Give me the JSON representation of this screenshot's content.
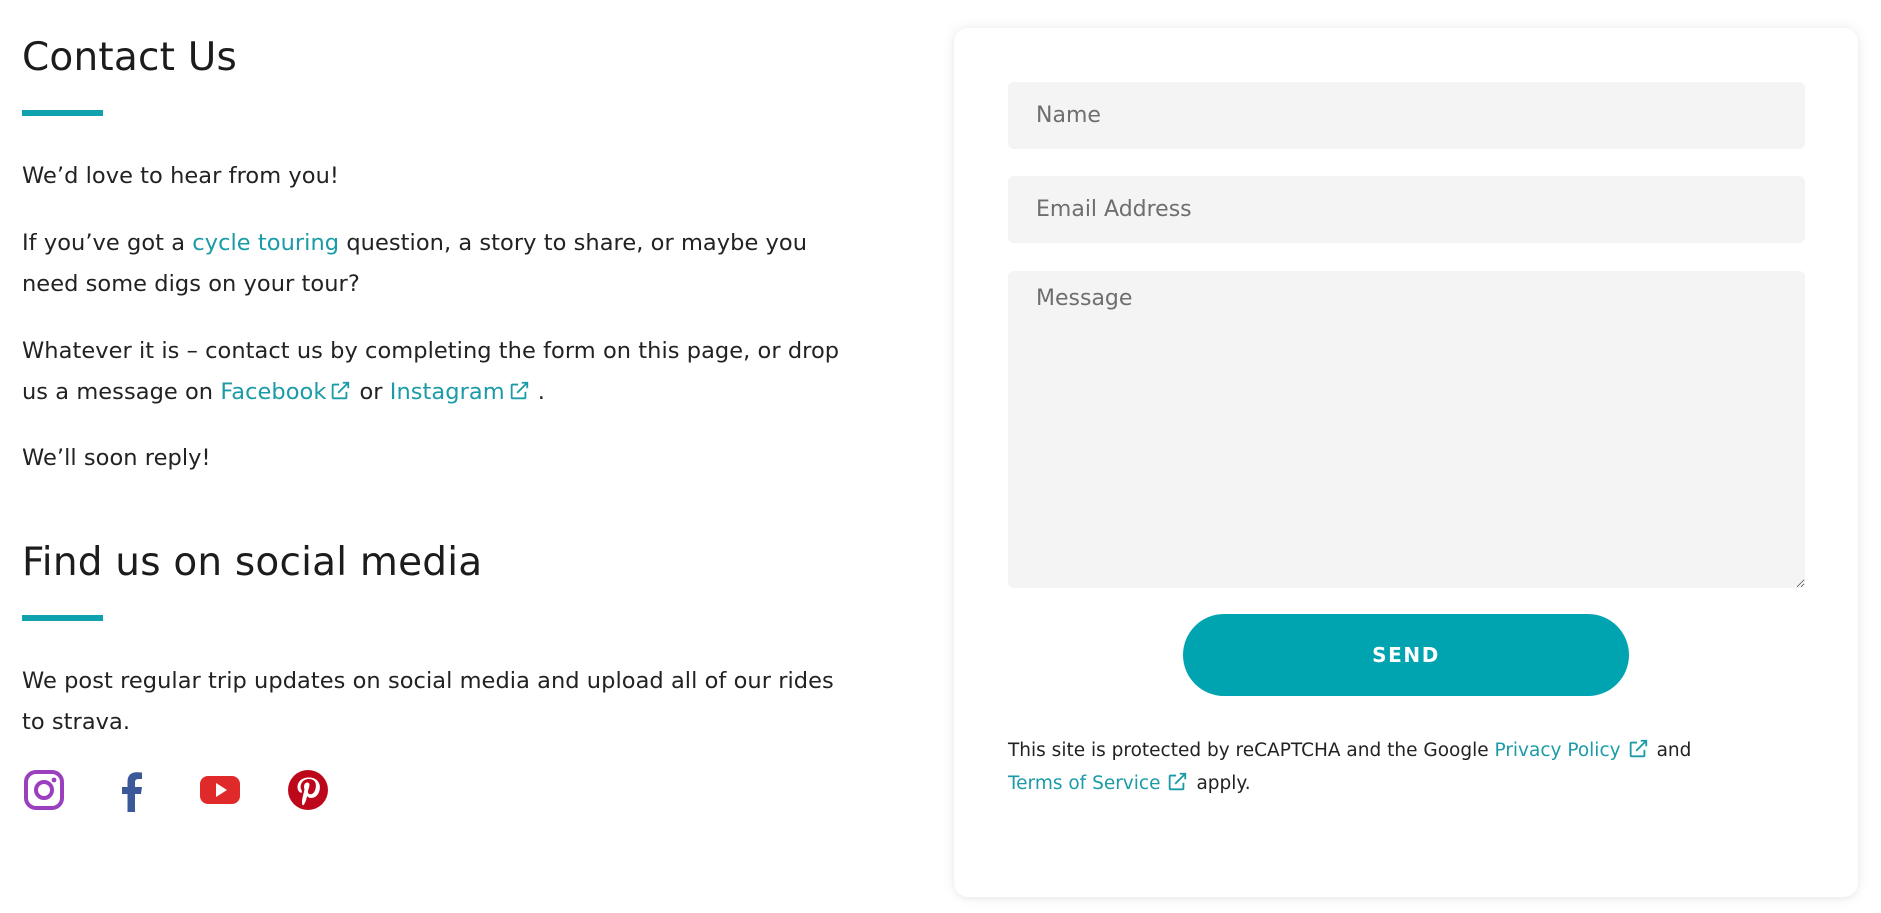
{
  "colors": {
    "accent": "#00a3b0",
    "link": "#1a9ba7",
    "field_bg": "#f4f4f4",
    "instagram": "#9b3fbf",
    "facebook": "#3b5998",
    "youtube": "#e02a2a",
    "pinterest": "#bd081c"
  },
  "contact": {
    "title": "Contact Us",
    "intro": "We’d love to hear from you!",
    "para2": {
      "before": "If you’ve got a ",
      "link": "cycle touring",
      "after": " question, a story to share, or maybe you need some digs on your tour?"
    },
    "para3": {
      "before": "Whatever it is – contact us by completing the form on this page, or drop us a message on ",
      "facebook_link": "Facebook",
      "middle": "or ",
      "instagram_link": "Instagram",
      "after": "."
    },
    "closing": "We’ll soon reply!"
  },
  "social": {
    "title": "Find us on social media",
    "description": "We post regular trip updates on social media and upload all of our rides to strava.",
    "icons": [
      {
        "name": "instagram-icon",
        "label": "Instagram"
      },
      {
        "name": "facebook-icon",
        "label": "Facebook"
      },
      {
        "name": "youtube-icon",
        "label": "YouTube"
      },
      {
        "name": "pinterest-icon",
        "label": "Pinterest"
      }
    ]
  },
  "form": {
    "name_placeholder": "Name",
    "name_value": "",
    "email_placeholder": "Email Address",
    "email_value": "",
    "message_placeholder": "Message",
    "message_value": "",
    "send_label": "SEND",
    "recaptcha": {
      "before": "This site is protected by reCAPTCHA and the Google ",
      "privacy_link": "Privacy Policy",
      "middle": "and",
      "terms_link": "Terms of Service",
      "after": "apply."
    }
  }
}
